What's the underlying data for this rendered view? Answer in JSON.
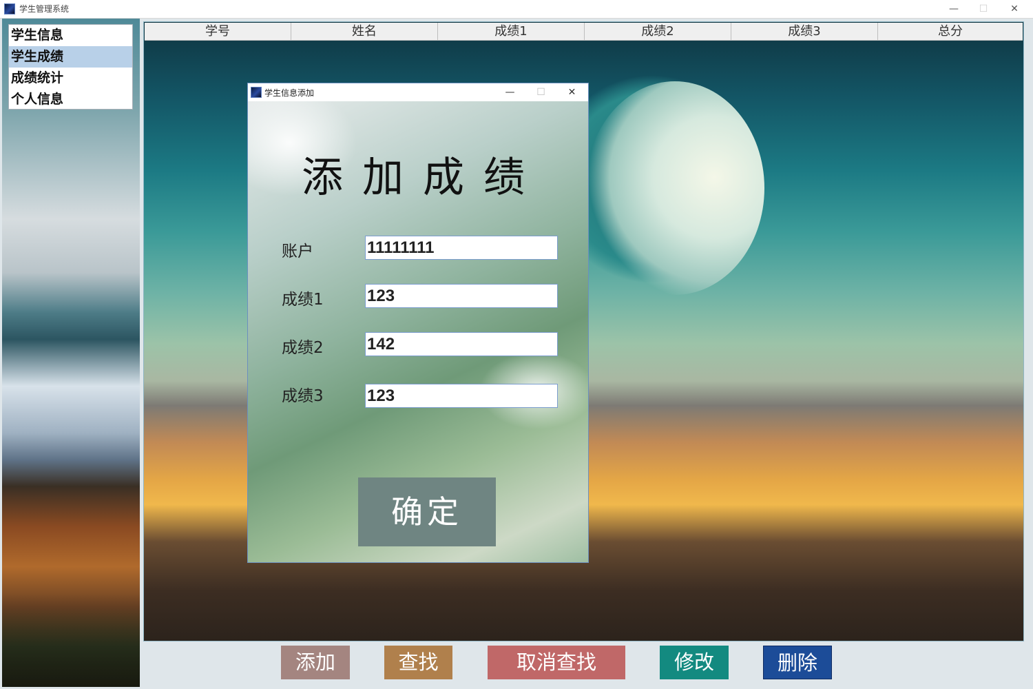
{
  "window": {
    "title": "学生管理系统",
    "controls": {
      "minimize": "—",
      "maximize": "☐",
      "close": "✕"
    }
  },
  "menu": {
    "items": [
      {
        "label": "学生信息",
        "selected": false
      },
      {
        "label": "学生成绩",
        "selected": true
      },
      {
        "label": "成绩统计",
        "selected": false
      },
      {
        "label": "个人信息",
        "selected": false
      }
    ]
  },
  "table": {
    "columns": [
      "学号",
      "姓名",
      "成绩1",
      "成绩2",
      "成绩3",
      "总分"
    ]
  },
  "buttons": {
    "add": {
      "label": "添加",
      "color": "#a48580"
    },
    "find": {
      "label": "查找",
      "color": "#b0804c"
    },
    "cancel_find": {
      "label": "取消查找",
      "color": "#c06868"
    },
    "modify": {
      "label": "修改",
      "color": "#138a80"
    },
    "delete": {
      "label": "删除",
      "color": "#1c4c98"
    }
  },
  "dialog": {
    "title": "学生信息添加",
    "controls": {
      "minimize": "—",
      "maximize": "☐",
      "close": "✕"
    },
    "heading": "添加成绩",
    "fields": {
      "account": {
        "label": "账户",
        "value": "11111111"
      },
      "score1": {
        "label": "成绩1",
        "value": "123"
      },
      "score2": {
        "label": "成绩2",
        "value": "142"
      },
      "score3": {
        "label": "成绩3",
        "value": "123"
      }
    },
    "confirm_label": "确定"
  }
}
